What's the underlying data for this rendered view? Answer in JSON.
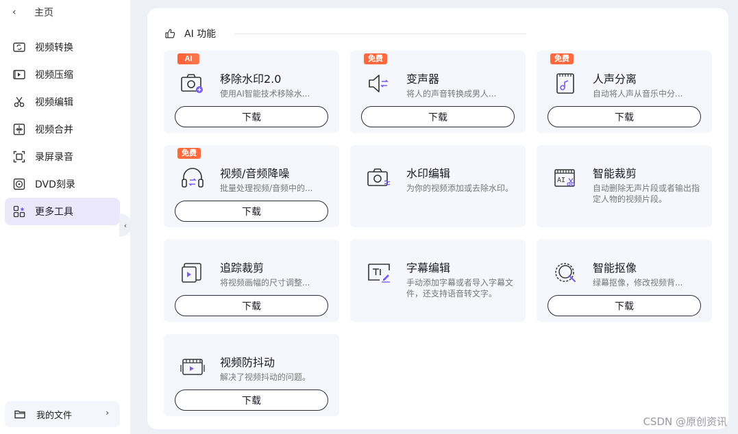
{
  "sidebar": {
    "home_label": "主页",
    "items": [
      {
        "label": "视频转换",
        "icon": "video-convert-icon"
      },
      {
        "label": "视频压缩",
        "icon": "video-compress-icon"
      },
      {
        "label": "视频编辑",
        "icon": "scissors-icon"
      },
      {
        "label": "视频合并",
        "icon": "merge-icon"
      },
      {
        "label": "录屏录音",
        "icon": "screen-record-icon"
      },
      {
        "label": "DVD刻录",
        "icon": "dvd-icon"
      },
      {
        "label": "更多工具",
        "icon": "more-tools-icon",
        "active": true
      }
    ],
    "my_files_label": "我的文件"
  },
  "section": {
    "title": "AI 功能"
  },
  "cards": [
    {
      "badge": "AI",
      "title": "移除水印2.0",
      "desc": "使用AI智能技术移除水...",
      "button": "下载",
      "icon": "watermark-remove-icon"
    },
    {
      "badge": "免费",
      "title": "变声器",
      "desc": "将人的声音转换成男人...",
      "button": "下载",
      "icon": "voice-changer-icon"
    },
    {
      "badge": "免费",
      "title": "人声分离",
      "desc": "自动将人声从音乐中分...",
      "button": "下载",
      "icon": "vocal-separate-icon"
    },
    {
      "badge": "免费",
      "title": "视频/音频降噪",
      "desc": "批量处理视频/音频中的...",
      "button": "下载",
      "icon": "noise-reduce-icon"
    },
    {
      "badge": "",
      "title": "水印编辑",
      "desc": "为你的视频添加或去除水印。",
      "button": "",
      "icon": "watermark-edit-icon"
    },
    {
      "badge": "",
      "title": "智能裁剪",
      "desc": "自动删除无声片段或者输出指定人物的视频片段。",
      "button": "",
      "icon": "smart-cut-icon"
    },
    {
      "badge": "",
      "title": "追踪裁剪",
      "desc": "将视频画幅的尺寸调整...",
      "button": "下载",
      "icon": "track-crop-icon"
    },
    {
      "badge": "",
      "title": "字幕编辑",
      "desc": "手动添加字幕或者导入字幕文件，还支持语音转文字。",
      "button": "",
      "icon": "subtitle-edit-icon"
    },
    {
      "badge": "",
      "title": "智能抠像",
      "desc": "绿幕抠像，修改视频背...",
      "button": "下载",
      "icon": "smart-matting-icon"
    },
    {
      "badge": "",
      "title": "视频防抖动",
      "desc": "解决了视频抖动的问题。",
      "button": "下载",
      "icon": "stabilize-icon"
    }
  ],
  "watermark": "CSDN @原创资讯",
  "colors": {
    "accent": "#7b5cf0",
    "badge": "#ff6a3d",
    "active_bg": "#ece8fc"
  }
}
